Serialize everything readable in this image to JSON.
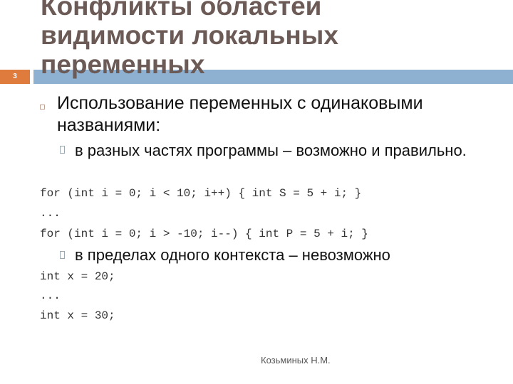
{
  "slide": {
    "title_lines": [
      "Конфликты областей",
      "видимости локальных",
      "переменных"
    ],
    "slide_number": "3",
    "bullet_main": "Использование переменных с одинаковыми названиями:",
    "sub_bullet_1": " в разных частях программы – возможно и правильно.",
    "code_block_1": [
      "for (int i = 0; i < 10; i++) { int S = 5 + i; }",
      "...",
      "for (int i = 0; i > -10; i--) { int P = 5 + i; }"
    ],
    "sub_bullet_2": "в пределах одного контекста – невозможно",
    "code_block_2": [
      "int x = 20;",
      "...",
      "int x = 30;"
    ],
    "footer": "Козьминых Н.М."
  },
  "colors": {
    "title": "#6b5a55",
    "number_box": "#e07b3e",
    "accent_bar": "#8eb1d2"
  }
}
